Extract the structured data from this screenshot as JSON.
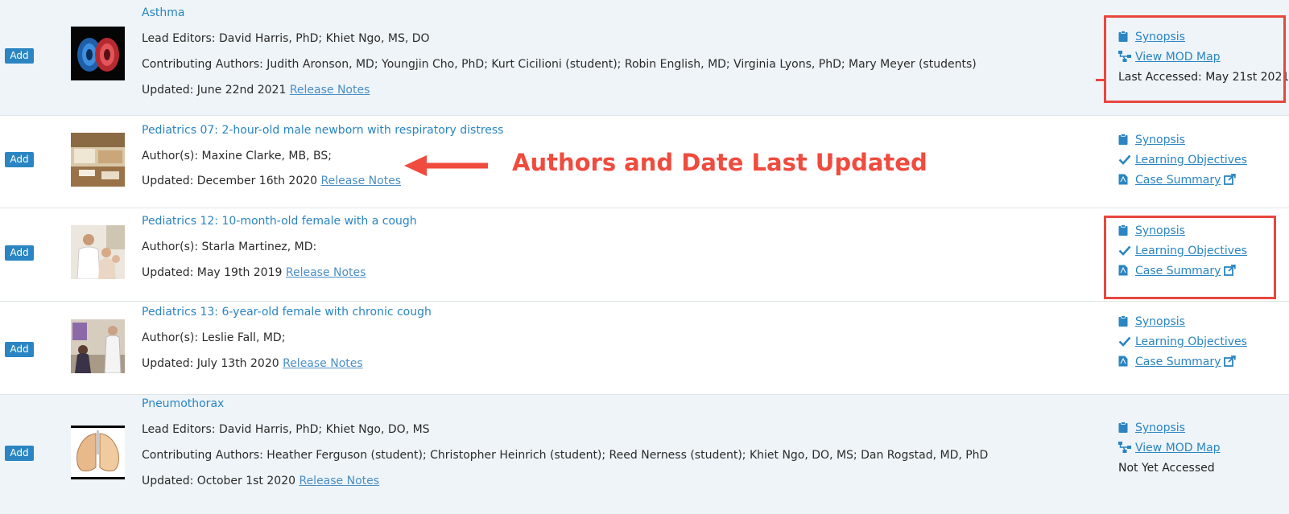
{
  "add_label": "Add",
  "rows": [
    {
      "title": "Asthma",
      "lines": [
        "Lead Editors: David Harris, PhD; Khiet Ngo, MS, DO",
        "Contributing Authors: Judith Aronson, MD; Youngjin Cho, PhD; Kurt Cicilioni (student); Robin English, MD; Virginia Lyons, PhD; Mary Meyer (students)"
      ],
      "updated": "Updated: June 22nd 2021",
      "release_notes": "Release Notes",
      "side": {
        "synopsis": "Synopsis",
        "view_mod_map": "View MOD Map",
        "last_accessed": "Last Accessed: May 21st 2021"
      }
    },
    {
      "title": "Pediatrics 07: 2-hour-old male newborn with respiratory distress",
      "lines": [
        "Author(s): Maxine Clarke, MB, BS;"
      ],
      "updated": "Updated: December 16th 2020",
      "release_notes": "Release Notes",
      "side": {
        "synopsis": "Synopsis",
        "learning_objectives": "Learning Objectives",
        "case_summary": "Case Summary"
      }
    },
    {
      "title": "Pediatrics 12: 10-month-old female with a cough",
      "lines": [
        "Author(s): Starla Martinez, MD:"
      ],
      "updated": "Updated: May 19th 2019",
      "release_notes": "Release Notes",
      "side": {
        "synopsis": "Synopsis",
        "learning_objectives": "Learning Objectives",
        "case_summary": "Case Summary"
      }
    },
    {
      "title": "Pediatrics 13: 6-year-old female with chronic cough",
      "lines": [
        "Author(s): Leslie Fall, MD;"
      ],
      "updated": "Updated: July 13th 2020",
      "release_notes": "Release Notes",
      "side": {
        "synopsis": "Synopsis",
        "learning_objectives": "Learning Objectives",
        "case_summary": "Case Summary"
      }
    },
    {
      "title": "Pneumothorax",
      "lines": [
        "Lead Editors: David Harris, PhD; Khiet Ngo, DO, MS",
        "Contributing Authors: Heather Ferguson (student); Christopher Heinrich (student); Reed Nerness (student); Khiet Ngo, DO, MS; Dan Rogstad, MD, PhD"
      ],
      "updated": "Updated: October 1st 2020",
      "release_notes": "Release Notes",
      "side": {
        "synopsis": "Synopsis",
        "view_mod_map": "View MOD Map",
        "last_accessed": "Not Yet Accessed"
      }
    }
  ],
  "annotation": {
    "text": "Authors and Date Last Updated"
  },
  "colors": {
    "link": "#2a85c2",
    "button": "#2a85c2",
    "highlight": "#e8473e",
    "row_shade": "#eef4f8"
  },
  "icons": [
    "clipboard-icon",
    "sitemap-icon",
    "check-icon",
    "pdf-file-icon",
    "external-link-icon"
  ]
}
